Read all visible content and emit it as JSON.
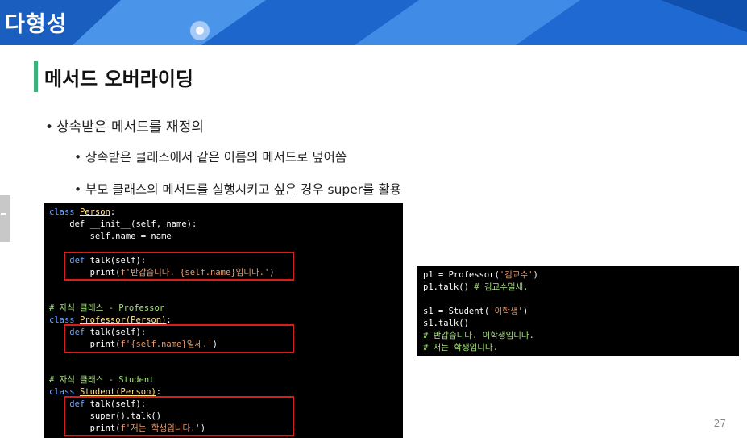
{
  "banner": {
    "title": "다형성"
  },
  "section": {
    "title": "메서드 오버라이딩"
  },
  "bullets": {
    "main": "상속받은 메서드를 재정의",
    "sub1": "상속받은 클래스에서 같은 이름의 메서드로 덮어씀",
    "sub2": "부모 클래스의 메서드를 실행시키고 싶은 경우 super를 활용",
    "dot": "•"
  },
  "code_left": {
    "l1_kw": "class",
    "l1_cls": "Person",
    "l1_end": ":",
    "l2": "    def __init__(self, name):",
    "l3": "        self.name = name",
    "l4_kw": "    def",
    "l4_rest": " talk(self):",
    "l5_a": "        print(",
    "l5_str": "f'반갑습니다. {self.name}입니다.'",
    "l5_b": ")",
    "c1": "# 자식 클래스 - Professor",
    "l6_kw": "class",
    "l6_cls": "Professor(Person)",
    "l6_end": ":",
    "l7_kw": "    def",
    "l7_rest": " talk(self):",
    "l8_a": "        print(",
    "l8_str": "f'{self.name}일세.'",
    "l8_b": ")",
    "c2": "# 자식 클래스 - Student",
    "l9_kw": "class",
    "l9_cls": "Student(Person)",
    "l9_end": ":",
    "l10_kw": "    def",
    "l10_rest": " talk(self):",
    "l11": "        super().talk()",
    "l12_a": "        print(",
    "l12_str": "f'저는 학생입니다.'",
    "l12_b": ")"
  },
  "code_right": {
    "r1_a": "p1 = Professor(",
    "r1_str": "'김교수'",
    "r1_b": ")",
    "r2_a": "p1.talk() ",
    "r2_cmt": "# 김교수일세.",
    "r3_a": "s1 = Student(",
    "r3_str": "'이학생'",
    "r3_b": ")",
    "r4": "s1.talk()",
    "r5": "# 반갑습니다. 이학생입니다.",
    "r6": "# 저는 학생입니다."
  },
  "page": {
    "number": "27"
  },
  "colors": {
    "accent_bar": "#3ab37a",
    "highlight_box": "#d71f1f",
    "banner": "#1f6fd0"
  }
}
